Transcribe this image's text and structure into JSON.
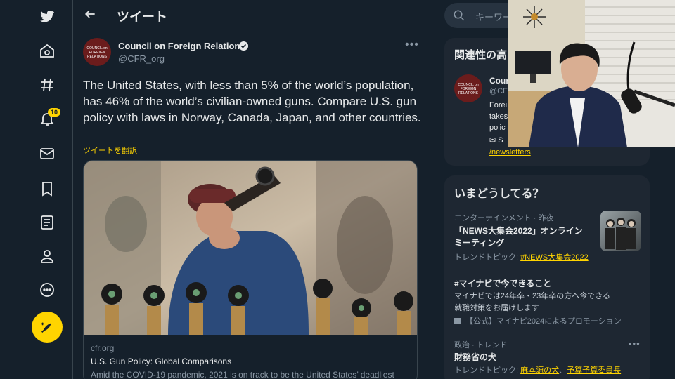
{
  "nav": {
    "notifications_count": "10"
  },
  "header": {
    "title": "ツイート"
  },
  "tweet": {
    "author_name": "Council on Foreign Relations",
    "author_handle": "@CFR_org",
    "avatar_text": "COUNCIL on FOREIGN RELATIONS",
    "text": "The United States, with less than 5% of the world’s population, has 46% of the world’s civilian-owned guns. Compare U.S. gun policy with laws in Norway, Canada, Japan, and other countries.",
    "translate_label": "ツイートを翻訳",
    "card": {
      "domain": "cfr.org",
      "title": "U.S. Gun Policy: Global Comparisons",
      "description": "Amid the COVID-19 pandemic, 2021 is on track to be the United States’ deadliest"
    }
  },
  "search": {
    "placeholder": "キーワード"
  },
  "related": {
    "title": "関連性の高",
    "name": "Cour",
    "handle": "@CF",
    "bio_lines": [
      "Forei",
      "takes",
      "polic",
      "✉ S"
    ],
    "link": "/newsletters"
  },
  "trends": {
    "title": "いまどうしてる？",
    "items": [
      {
        "category": "エンターテインメント · 昨夜",
        "name_line1": "「NEWS大集会2022」オンライン",
        "name_line2": "ミーティング",
        "sub_prefix": "トレンドトピック: ",
        "sub_link": "#NEWS大集会2022"
      },
      {
        "name": "#マイナビで今できること",
        "desc_line1": "マイナビでは24年卒・23年卒の方へ今できる",
        "desc_line2": "就職対策をお届けします",
        "promo": "【公式】マイナビ2024によるプロモーション"
      },
      {
        "category": "政治 · トレンド",
        "name": "財務省の犬",
        "sub_prefix": "トレンドトピック: ",
        "sub_link1": "麻本源の犬",
        "sub_sep": "、",
        "sub_link2": "予算予算委員長"
      }
    ]
  },
  "colors": {
    "background": "#15202b",
    "accent": "#ffd400",
    "panel": "#1e2732",
    "border": "#38444d",
    "muted": "#8b98a5"
  }
}
